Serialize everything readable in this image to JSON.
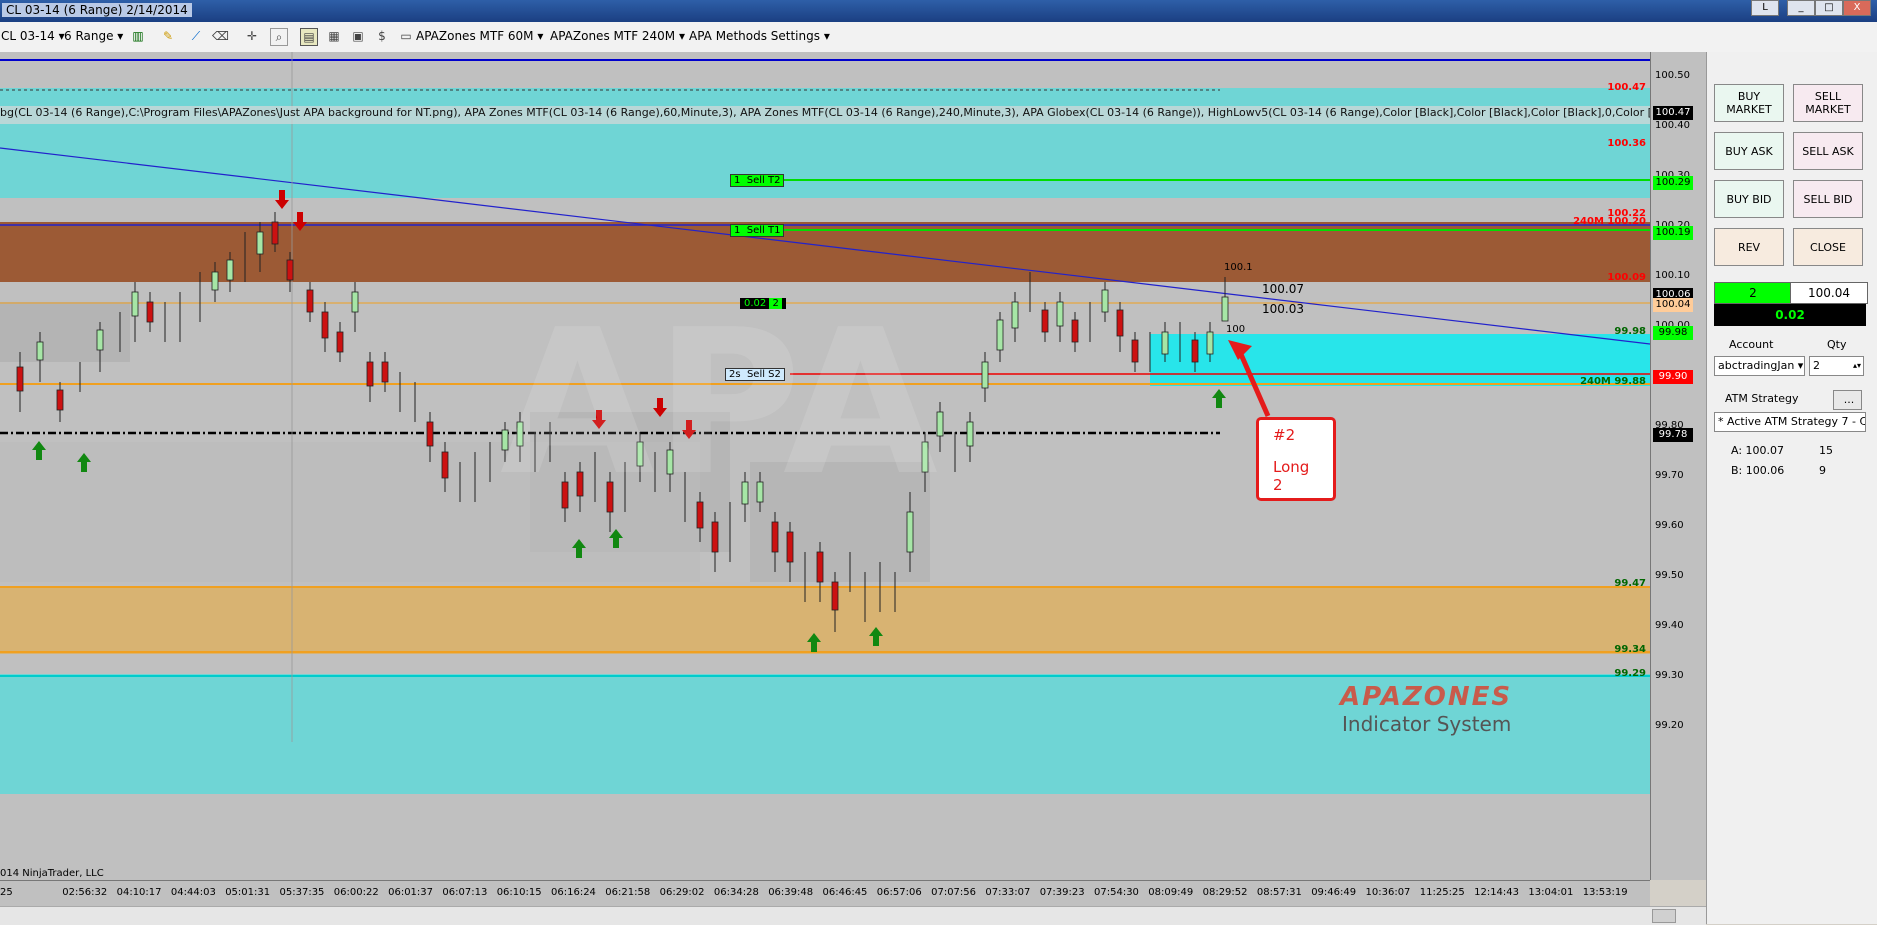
{
  "window": {
    "title": "CL 03-14 (6 Range)  2/14/2014",
    "buttons": [
      "L",
      "_",
      "□",
      "X"
    ]
  },
  "toolbar": {
    "instrument": "CL 03-14",
    "interval": "6 Range",
    "templates": [
      "APAZones MTF 60M",
      "APAZones MTF 240M",
      "APA Methods Settings"
    ]
  },
  "chart_header": "bg(CL 03-14 (6 Range),C:\\Program Files\\APAZones\\Just APA background for NT.png), APA Zones MTF(CL 03-14 (6 Range),60,Minute,3), APA Zones MTF(CL 03-14 (6 Range),240,Minute,3), APA Globex(CL 03-14 (6 Range)), HighLowv5(CL 03-14 (6 Range),Color [Black],Color [Black],Color [Black],0,Color [Black],8,0,0,False,True,F",
  "y_axis": {
    "ticks": [
      "100.50",
      "100.40",
      "100.30",
      "100.20",
      "100.10",
      "100.00",
      "99.90",
      "99.80",
      "99.70",
      "99.60",
      "99.50",
      "99.40",
      "99.30",
      "99.20"
    ],
    "price_tags": [
      {
        "text": "100.47",
        "bg": "#000000",
        "fg": "#ffffff"
      },
      {
        "text": "100.29",
        "bg": "#00ff00",
        "fg": "#000000"
      },
      {
        "text": "100.19",
        "bg": "#00ff00",
        "fg": "#000000"
      },
      {
        "text": "100.06",
        "bg": "#000000",
        "fg": "#ffffff"
      },
      {
        "text": "100.04",
        "bg": "#ffcc99",
        "fg": "#000000"
      },
      {
        "text": "99.98",
        "bg": "#00ff00",
        "fg": "#000000"
      },
      {
        "text": "99.90",
        "bg": "#ff0000",
        "fg": "#ffffff"
      },
      {
        "text": "99.78",
        "bg": "#000000",
        "fg": "#ffffff"
      }
    ],
    "zone_labels": [
      {
        "text": "100.47",
        "color": "#ff0000"
      },
      {
        "text": "100.36",
        "color": "#ff0000"
      },
      {
        "text": "100.22",
        "color": "#ff0000"
      },
      {
        "text": "240M 100.20",
        "color": "#ff0000"
      },
      {
        "text": "100.09",
        "color": "#ff0000"
      },
      {
        "text": "99.98",
        "color": "#006600"
      },
      {
        "text": "240M 99.88",
        "color": "#006600"
      },
      {
        "text": "99.47",
        "color": "#006600"
      },
      {
        "text": "99.34",
        "color": "#006600"
      },
      {
        "text": "99.29",
        "color": "#006600"
      }
    ]
  },
  "x_axis": [
    "25",
    "02:56:32",
    "04:10:17",
    "04:44:03",
    "05:01:31",
    "05:37:35",
    "06:00:22",
    "06:01:37",
    "06:07:13",
    "06:10:15",
    "06:16:24",
    "06:21:58",
    "06:29:02",
    "06:34:28",
    "06:39:48",
    "06:46:45",
    "06:57:06",
    "07:07:56",
    "07:33:07",
    "07:39:23",
    "07:54:30",
    "08:09:49",
    "08:29:52",
    "08:57:31",
    "09:46:49",
    "10:36:07",
    "11:25:25",
    "12:14:43",
    "13:04:01",
    "13:53:19"
  ],
  "orders": [
    {
      "qty": "1",
      "label": "Sell T2"
    },
    {
      "qty": "1",
      "label": "Sell T1"
    },
    {
      "qty": "2s",
      "label": "Sell S2"
    }
  ],
  "position_marker": {
    "pnl": "0.02",
    "qty": "2"
  },
  "annotations": {
    "high": "100.1",
    "low": "100",
    "ask": "100.07",
    "bid": "100.03",
    "callout_line1": "#2",
    "callout_line2": "Long 2"
  },
  "watermark": {
    "line1": "APAZONES",
    "line2": "Indicator System"
  },
  "copyright": "014 NinjaTrader, LLC",
  "panel": {
    "buy_market": "BUY MARKET",
    "sell_market": "SELL MARKET",
    "buy_ask": "BUY ASK",
    "sell_ask": "SELL ASK",
    "buy_bid": "BUY BID",
    "sell_bid": "SELL BID",
    "rev": "REV",
    "close": "CLOSE",
    "position_qty": "2",
    "position_price": "100.04",
    "unrealized": "0.02",
    "account_label": "Account",
    "qty_label": "Qty",
    "account_value": "abctradingJan",
    "qty_value": "2",
    "atm_label": "ATM Strategy",
    "atm_btn": "...",
    "atm_value": "* Active ATM Strategy 7 - C",
    "ask_label": "A: 100.07",
    "ask_size": "15",
    "bid_label": "B: 100.06",
    "bid_size": "9"
  }
}
